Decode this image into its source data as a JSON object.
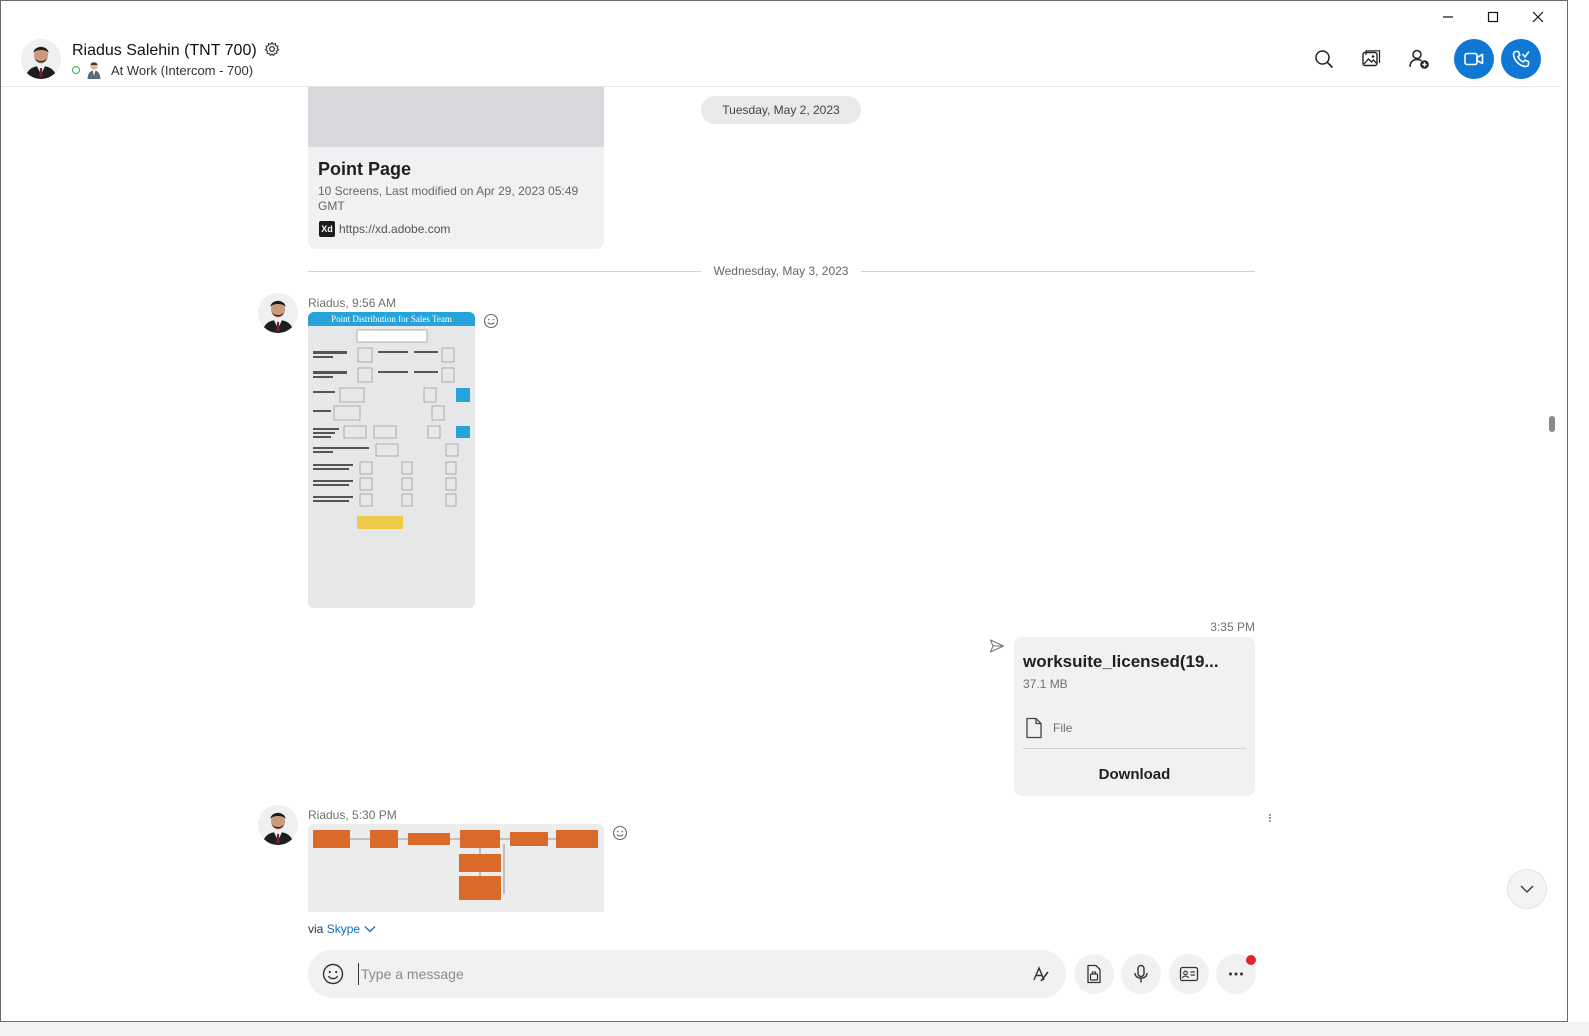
{
  "header": {
    "contact_name": "Riadus Salehin (TNT 700)",
    "status_text": "At Work (Intercom - 700)",
    "icons": [
      "search-icon",
      "gallery-icon",
      "add-person-icon",
      "video-call-icon",
      "audio-call-icon"
    ]
  },
  "window_controls": [
    "minimize-icon",
    "maximize-icon",
    "close-icon"
  ],
  "colors": {
    "accent": "#0f78d4",
    "presence": "#2bb34a",
    "notification": "#e0262b"
  },
  "link_card": {
    "title": "Point Page",
    "meta": "10 Screens, Last modified on Apr 29, 2023 05:49 GMT",
    "badge": "Xd",
    "url": "https://xd.adobe.com"
  },
  "dates": {
    "pill": "Tuesday, May 2, 2023",
    "divider": "Wednesday, May 3, 2023"
  },
  "messages": [
    {
      "sender": "Riadus, 9:56 AM",
      "image_heading": "Point Distribution for Sales Team"
    },
    {
      "time": "3:35 PM",
      "file_name": "worksuite_licensed(19...",
      "file_size": "37.1 MB",
      "file_type": "File",
      "download_label": "Download"
    },
    {
      "sender": "Riadus, 5:30 PM"
    }
  ],
  "footer": {
    "via": "via",
    "via_link": "Skype"
  },
  "composer": {
    "placeholder": "Type a message"
  }
}
